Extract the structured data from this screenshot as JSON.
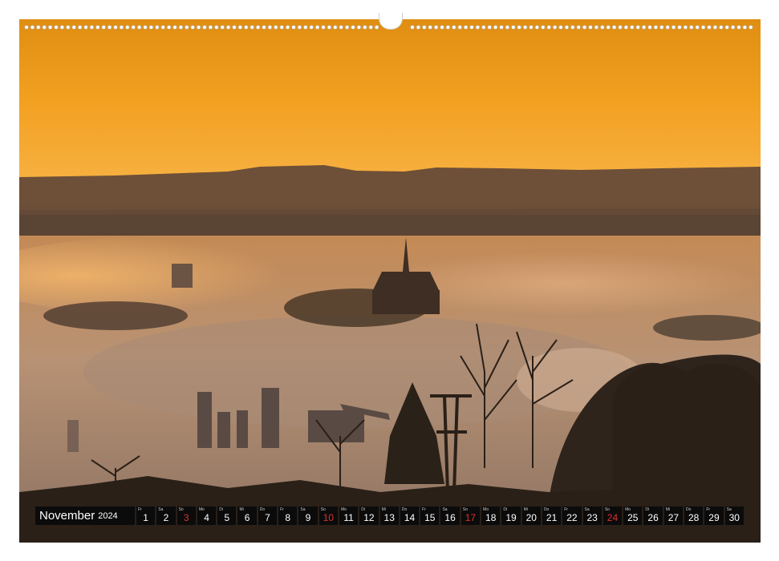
{
  "calendar": {
    "month": "November",
    "year": "2024",
    "days": [
      {
        "wd": "Fr",
        "n": "1",
        "red": false
      },
      {
        "wd": "Sa",
        "n": "2",
        "red": false
      },
      {
        "wd": "So",
        "n": "3",
        "red": true
      },
      {
        "wd": "Mo",
        "n": "4",
        "red": false
      },
      {
        "wd": "Di",
        "n": "5",
        "red": false
      },
      {
        "wd": "Mi",
        "n": "6",
        "red": false
      },
      {
        "wd": "Do",
        "n": "7",
        "red": false
      },
      {
        "wd": "Fr",
        "n": "8",
        "red": false
      },
      {
        "wd": "Sa",
        "n": "9",
        "red": false
      },
      {
        "wd": "So",
        "n": "10",
        "red": true
      },
      {
        "wd": "Mo",
        "n": "11",
        "red": false
      },
      {
        "wd": "Di",
        "n": "12",
        "red": false
      },
      {
        "wd": "Mi",
        "n": "13",
        "red": false
      },
      {
        "wd": "Do",
        "n": "14",
        "red": false
      },
      {
        "wd": "Fr",
        "n": "15",
        "red": false
      },
      {
        "wd": "Sa",
        "n": "16",
        "red": false
      },
      {
        "wd": "So",
        "n": "17",
        "red": true
      },
      {
        "wd": "Mo",
        "n": "18",
        "red": false
      },
      {
        "wd": "Di",
        "n": "19",
        "red": false
      },
      {
        "wd": "Mi",
        "n": "20",
        "red": false
      },
      {
        "wd": "Do",
        "n": "21",
        "red": false
      },
      {
        "wd": "Fr",
        "n": "22",
        "red": false
      },
      {
        "wd": "Sa",
        "n": "23",
        "red": false
      },
      {
        "wd": "So",
        "n": "24",
        "red": true
      },
      {
        "wd": "Mo",
        "n": "25",
        "red": false
      },
      {
        "wd": "Di",
        "n": "26",
        "red": false
      },
      {
        "wd": "Mi",
        "n": "27",
        "red": false
      },
      {
        "wd": "Do",
        "n": "28",
        "red": false
      },
      {
        "wd": "Fr",
        "n": "29",
        "red": false
      },
      {
        "wd": "Sa",
        "n": "30",
        "red": false
      }
    ]
  },
  "colors": {
    "sky_top": "#e39a16",
    "sky_horizon": "#f7a01f",
    "fog": "#c9a07a",
    "silhouette": "#2a2018",
    "sunday_red": "#e03030"
  }
}
